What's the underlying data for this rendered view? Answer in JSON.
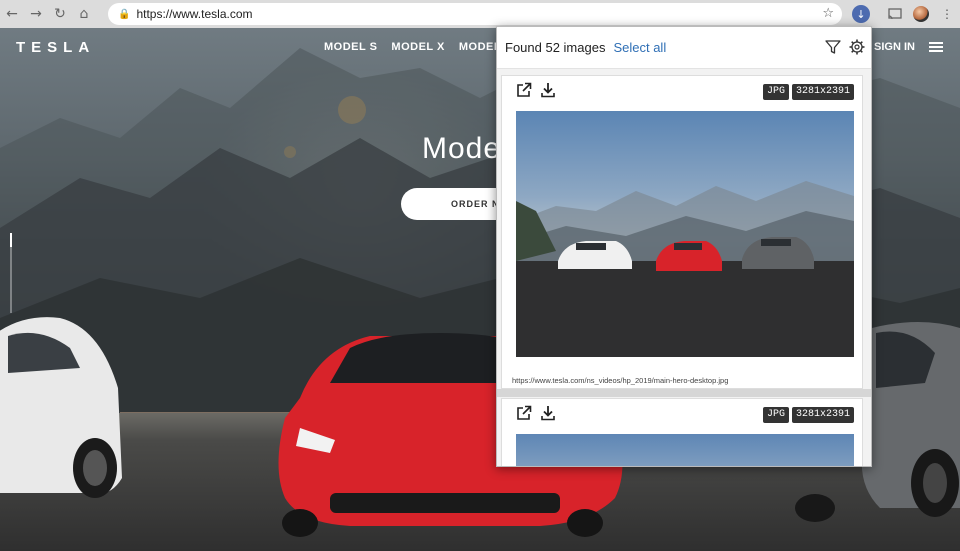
{
  "browser": {
    "url": "https://www.tesla.com",
    "nav_icons": [
      "back-icon",
      "forward-icon",
      "reload-icon",
      "home-icon"
    ],
    "extension_icons": [
      "image-downloader-extension-icon",
      "cast-icon",
      "profile-avatar",
      "more-menu-icon"
    ]
  },
  "site": {
    "logo": "TESLA",
    "nav": [
      "MODEL S",
      "MODEL X",
      "MODEL"
    ],
    "sign_in": "SIGN IN",
    "hero_title": "Mode",
    "order_button": "ORDER NO"
  },
  "popup": {
    "found_text": "Found 52 images",
    "select_all": "Select all",
    "header_icons": [
      "filter-icon",
      "settings-icon"
    ],
    "images": [
      {
        "format": "JPG",
        "dimensions": "3281x2391",
        "url": "https://www.tesla.com/ns_videos/hp_2019/main-hero-desktop.jpg",
        "actions": [
          "open-in-new-tab-icon",
          "download-icon"
        ]
      },
      {
        "format": "JPG",
        "dimensions": "3281x2391",
        "actions": [
          "open-in-new-tab-icon",
          "download-icon"
        ]
      }
    ]
  },
  "colors": {
    "link_blue": "#2f6fb5",
    "badge_bg": "#333333",
    "extension_active": "#4d6bb0",
    "car_red": "#d8232a"
  }
}
